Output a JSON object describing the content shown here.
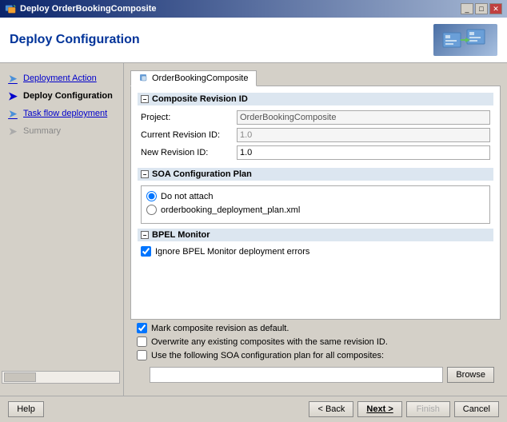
{
  "window": {
    "title": "Deploy OrderBookingComposite",
    "title_icon": "deploy-icon"
  },
  "header": {
    "title": "Deploy Configuration",
    "icon": "deploy-config-icon"
  },
  "nav": {
    "items": [
      {
        "id": "deployment-action",
        "label": "Deployment Action",
        "state": "link",
        "icon": "step-icon"
      },
      {
        "id": "deploy-configuration",
        "label": "Deploy Configuration",
        "state": "active",
        "icon": "step-icon"
      },
      {
        "id": "task-flow-deployment",
        "label": "Task flow deployment",
        "state": "link",
        "icon": "step-icon"
      },
      {
        "id": "summary",
        "label": "Summary",
        "state": "disabled",
        "icon": "step-icon"
      }
    ]
  },
  "tab": {
    "label": "OrderBookingComposite",
    "icon": "composite-icon"
  },
  "composite_revision": {
    "section_label": "Composite Revision ID",
    "project_label": "Project:",
    "project_value": "OrderBookingComposite",
    "current_revision_label": "Current Revision ID:",
    "current_revision_value": "1.0",
    "new_revision_label": "New Revision ID:",
    "new_revision_value": "1.0"
  },
  "soa_config": {
    "section_label": "SOA Configuration Plan",
    "option1": "Do not attach",
    "option2": "orderbooking_deployment_plan.xml"
  },
  "bpel_monitor": {
    "section_label": "BPEL Monitor",
    "checkbox_label": "Ignore BPEL Monitor deployment errors",
    "checked": true
  },
  "bottom_checkboxes": [
    {
      "id": "mark-default",
      "label": "Mark composite revision as default.",
      "checked": true
    },
    {
      "id": "overwrite",
      "label": "Overwrite any existing composites with the same revision ID.",
      "checked": false
    },
    {
      "id": "soa-plan",
      "label": "Use the following SOA configuration plan for all composites:",
      "checked": false
    }
  ],
  "bottom_input": {
    "value": "",
    "placeholder": ""
  },
  "browse_button": "Browse",
  "buttons": {
    "help": "Help",
    "back": "< Back",
    "next": "Next >",
    "finish": "Finish",
    "cancel": "Cancel"
  }
}
